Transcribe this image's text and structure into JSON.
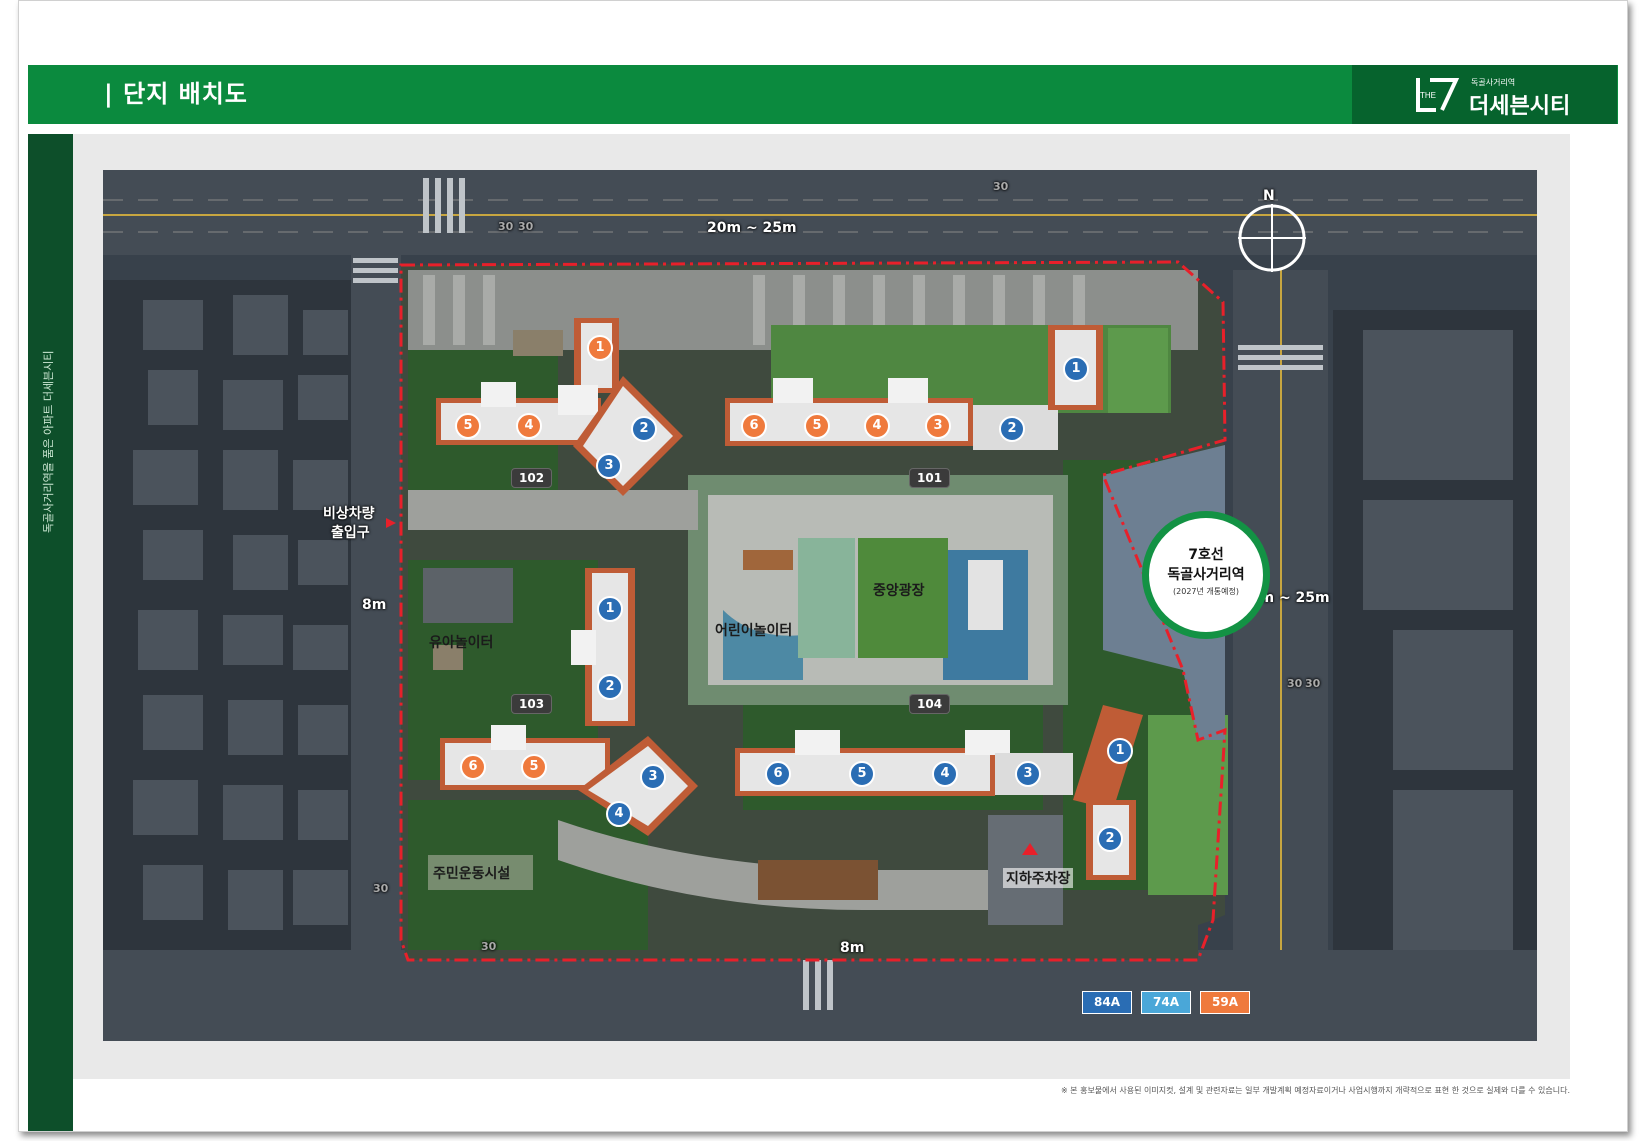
{
  "header": {
    "title": "| 단지 배치도"
  },
  "logo": {
    "small": "독골사거리역",
    "name": "더세븐시티",
    "colors": {
      "bar": "#0b8a3e",
      "box": "#06632d"
    }
  },
  "sidebar": {
    "text": "독골사거리역을 품은 아파트 더세븐시티"
  },
  "map": {
    "north": "N",
    "roads": {
      "top": "20m ~ 25m",
      "right": "20m ~ 25m",
      "left": "8m",
      "bottom": "8m"
    },
    "labels": {
      "emergency": [
        "비상차량",
        "출입구"
      ],
      "infant_play": "유아놀이터",
      "kids_play": "어린이놀이터",
      "central_plaza": "중앙광장",
      "resident_fitness": "주민운동시설",
      "underground_parking": "지하주차장"
    },
    "buildings": [
      "102",
      "101",
      "103",
      "104"
    ],
    "station": {
      "line": "7호선",
      "name": "독골사거리역",
      "note": "(2027년 개통예정)"
    },
    "units": {
      "b102": [
        "1",
        "5",
        "4",
        "2",
        "3"
      ],
      "b101": [
        "1",
        "6",
        "5",
        "4",
        "3",
        "2"
      ],
      "b103": [
        "1",
        "2",
        "6",
        "5",
        "3",
        "4"
      ],
      "b104": [
        "1",
        "6",
        "5",
        "4",
        "3",
        "2"
      ]
    },
    "legend": [
      {
        "label": "84A",
        "color": "#2a6db4"
      },
      {
        "label": "74A",
        "color": "#4aa7d8"
      },
      {
        "label": "59A",
        "color": "#ef7a3d"
      }
    ],
    "road_marks": [
      "30",
      "30",
      "30",
      "30",
      "30",
      "30",
      "30"
    ]
  },
  "disclaimer": "※ 본 홍보물에서 사용된 이미지컷, 설계 및 관련자료는 일부 개발계획 예정자료이거나 사업시행까지 개략적으로 표현 한 것으로 실제와 다를 수 있습니다."
}
